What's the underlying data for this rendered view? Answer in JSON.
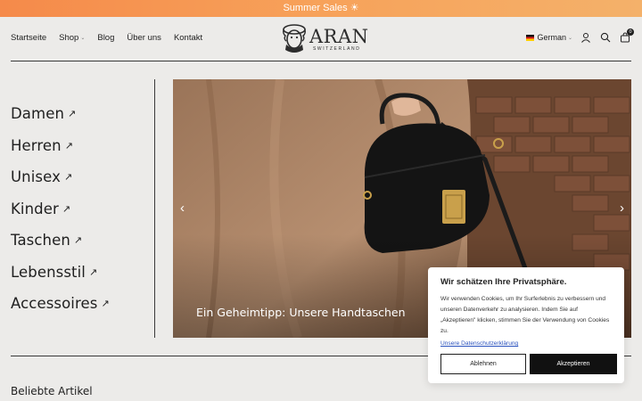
{
  "promo": {
    "text": "Summer Sales ☀"
  },
  "nav": {
    "items": [
      {
        "label": "Startseite"
      },
      {
        "label": "Shop",
        "has_dropdown": true
      },
      {
        "label": "Blog"
      },
      {
        "label": "Über uns"
      },
      {
        "label": "Kontakt"
      }
    ]
  },
  "logo": {
    "word": "ARAN",
    "sub": "SWITZERLAND"
  },
  "tools": {
    "language": "German",
    "cart_count": "0",
    "icons": [
      "user-icon",
      "search-icon",
      "cart-icon"
    ]
  },
  "categories": [
    {
      "label": "Damen"
    },
    {
      "label": "Herren"
    },
    {
      "label": "Unisex"
    },
    {
      "label": "Kinder"
    },
    {
      "label": "Taschen"
    },
    {
      "label": "Lebensstil"
    },
    {
      "label": "Accessoires"
    }
  ],
  "hero": {
    "caption": "Ein Geheimtipp: Unsere Handtaschen",
    "prev": "‹",
    "next": "›"
  },
  "section": {
    "title": "Beliebte Artikel"
  },
  "cookie": {
    "title": "Wir schätzen Ihre Privatsphäre.",
    "text": "Wir verwenden Cookies, um Ihr Surferlebnis zu verbessern und unseren Datenverkehr zu analysieren. Indem Sie auf „Akzeptieren\" klicken, stimmen Sie der Verwendung von Cookies zu.",
    "link": "Unsere Datenschutzerklärung",
    "reject": "Ablehnen",
    "accept": "Akzeptieren"
  },
  "colors": {
    "promo_start": "#f58a4a",
    "promo_end": "#f4b16a",
    "page_bg": "#ecebe9",
    "link": "#2a52be",
    "accept_bg": "#111111"
  }
}
